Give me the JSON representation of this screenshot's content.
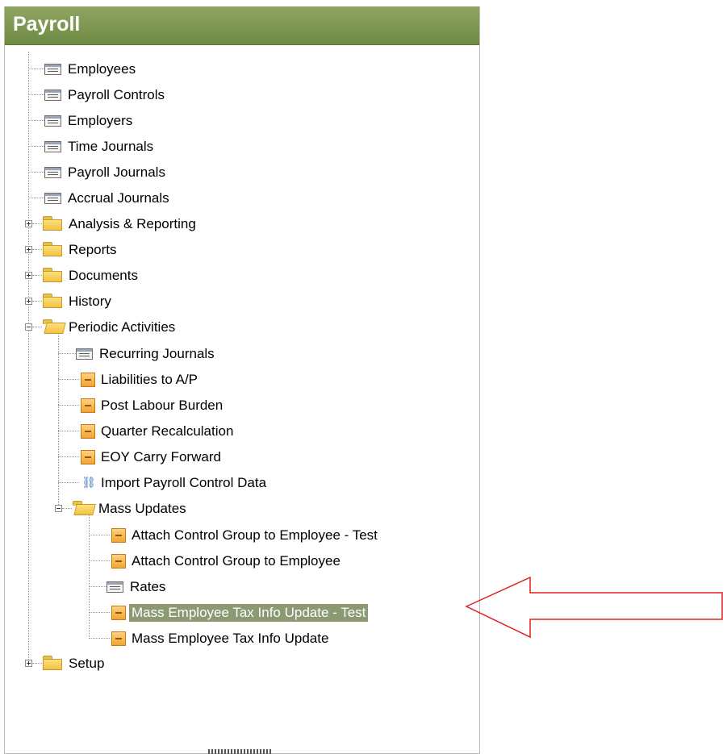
{
  "panel": {
    "title": "Payroll"
  },
  "tree": {
    "items": [
      {
        "label": "Employees"
      },
      {
        "label": "Payroll Controls"
      },
      {
        "label": "Employers"
      },
      {
        "label": "Time Journals"
      },
      {
        "label": "Payroll Journals"
      },
      {
        "label": "Accrual Journals"
      },
      {
        "label": "Analysis & Reporting"
      },
      {
        "label": "Reports"
      },
      {
        "label": "Documents"
      },
      {
        "label": "History"
      },
      {
        "label": "Periodic Activities"
      },
      {
        "label": "Recurring Journals"
      },
      {
        "label": "Liabilities to A/P"
      },
      {
        "label": "Post Labour Burden"
      },
      {
        "label": "Quarter Recalculation"
      },
      {
        "label": "EOY Carry Forward"
      },
      {
        "label": "Import Payroll Control Data"
      },
      {
        "label": "Mass Updates"
      },
      {
        "label": "Attach Control Group to Employee - Test"
      },
      {
        "label": "Attach Control Group to Employee"
      },
      {
        "label": "Rates"
      },
      {
        "label": "Mass Employee Tax Info Update - Test"
      },
      {
        "label": "Mass Employee Tax Info Update"
      },
      {
        "label": "Setup"
      }
    ]
  },
  "colors": {
    "header": "#7a9550",
    "selection": "#8b9a72",
    "annotation_arrow": "#e02020"
  }
}
